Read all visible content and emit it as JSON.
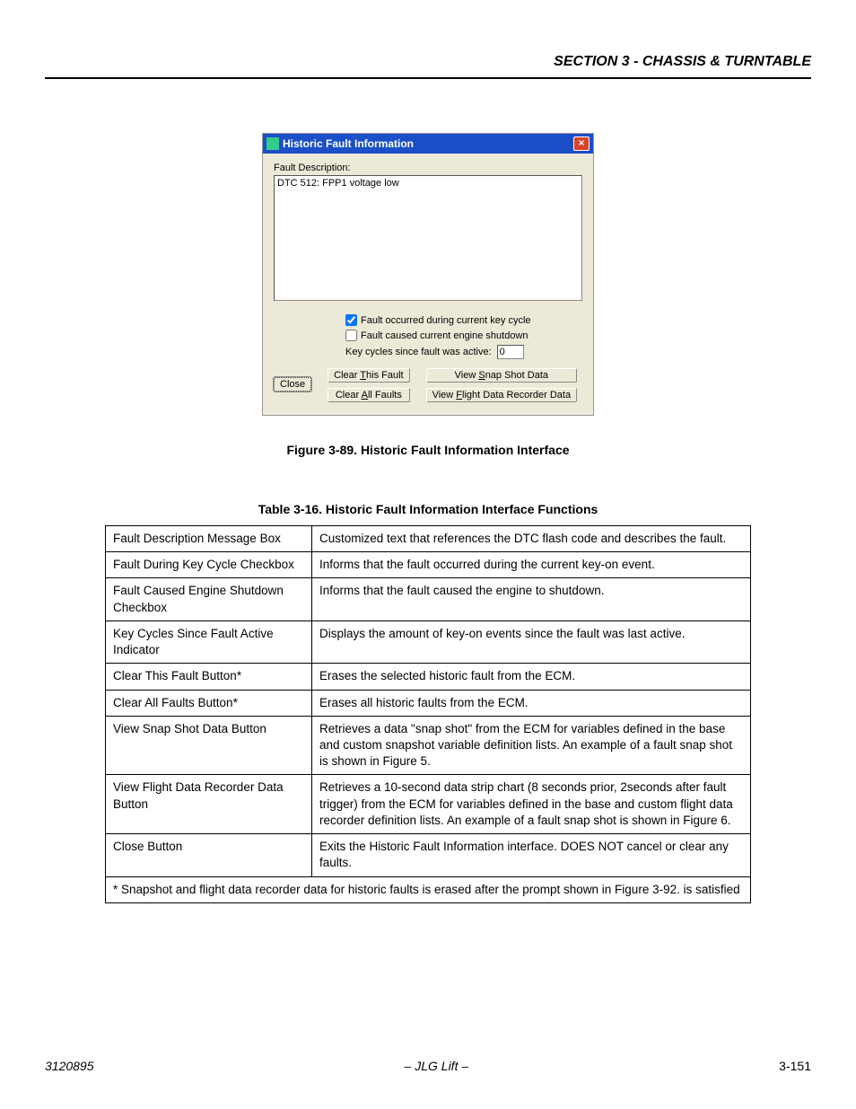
{
  "header": {
    "section_title": "SECTION 3 - CHASSIS & TURNTABLE"
  },
  "dialog": {
    "title": "Historic Fault Information",
    "fault_description_label": "Fault Description:",
    "fault_description_value": "DTC 512: FPP1 voltage low",
    "check1_label": "Fault occurred during current key cycle",
    "check2_label": "Fault caused current engine shutdown",
    "key_cycles_label": "Key cycles since fault was active:",
    "key_cycles_value": "0",
    "close_btn": "Close",
    "clear_this_btn_pre": "Clear ",
    "clear_this_btn_u": "T",
    "clear_this_btn_post": "his Fault",
    "clear_all_btn_pre": "Clear ",
    "clear_all_btn_u": "A",
    "clear_all_btn_post": "ll Faults",
    "snap_btn_pre": "View ",
    "snap_btn_u": "S",
    "snap_btn_post": "nap Shot Data",
    "flight_btn_pre": "View ",
    "flight_btn_u": "F",
    "flight_btn_post": "light Data Recorder Data"
  },
  "figure_caption": "Figure 3-89.  Historic Fault Information Interface",
  "table_caption": "Table 3-16.   Historic Fault Information Interface Functions",
  "table_rows": [
    {
      "c1": "Fault Description Message Box",
      "c2": "Customized text that references the DTC flash code and describes the fault."
    },
    {
      "c1": "Fault During Key Cycle Checkbox",
      "c2": "Informs that the fault occurred during the current key-on event."
    },
    {
      "c1": "Fault Caused Engine Shutdown Checkbox",
      "c2": "Informs that the fault caused the engine to shutdown."
    },
    {
      "c1": "Key Cycles Since Fault Active Indicator",
      "c2": "Displays the amount of key-on events since the fault was last active."
    },
    {
      "c1": "Clear This Fault Button*",
      "c2": "Erases the selected historic fault from the ECM."
    },
    {
      "c1": "Clear All Faults Button*",
      "c2": "Erases all historic faults from the ECM."
    },
    {
      "c1": "View Snap Shot Data Button",
      "c2": "Retrieves a data \"snap shot\" from the ECM for variables defined in the base and custom snapshot variable definition lists. An example of a fault snap shot is shown in Figure 5."
    },
    {
      "c1": "View Flight Data Recorder Data Button",
      "c2": "Retrieves a 10-second data strip chart (8 seconds prior, 2seconds after fault trigger) from the ECM for variables defined in the base and custom flight data recorder definition lists. An example of a fault snap shot is shown in Figure 6."
    },
    {
      "c1": "Close Button",
      "c2": "Exits the Historic Fault Information interface. DOES NOT cancel or clear any faults."
    }
  ],
  "table_footnote": "* Snapshot and flight data recorder data for historic faults is erased after the prompt shown in Figure 3-92. is satisfied",
  "footer": {
    "left": "3120895",
    "center": "– JLG Lift –",
    "right": "3-151"
  }
}
